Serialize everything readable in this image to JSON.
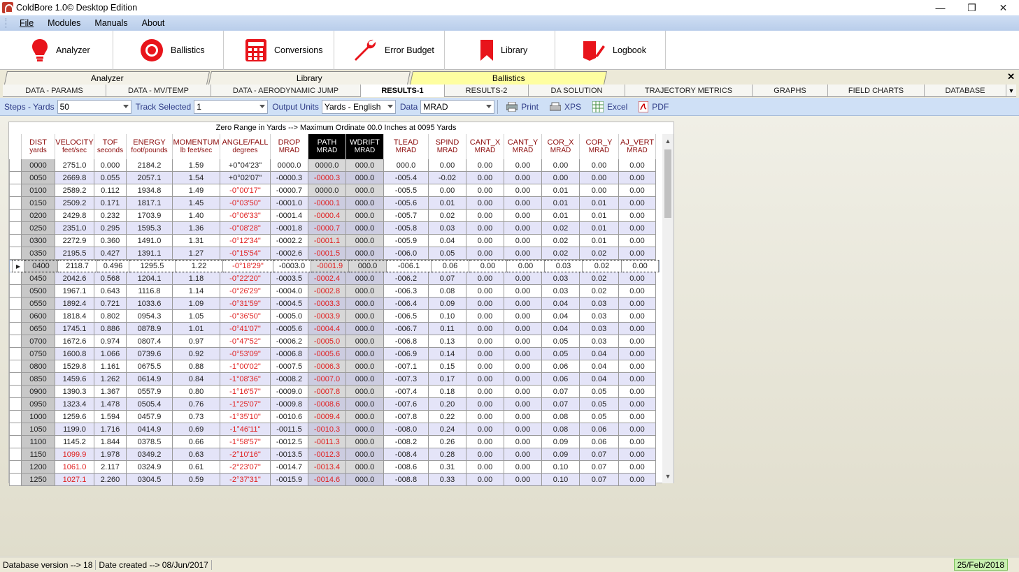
{
  "window": {
    "title": "ColdBore 1.0© Desktop Edition",
    "min": "—",
    "max": "❐",
    "close": "✕"
  },
  "menu": [
    "File",
    "Modules",
    "Manuals",
    "About"
  ],
  "toolbar": [
    {
      "label": "Analyzer",
      "icon": "bulb-icon"
    },
    {
      "label": "Ballistics",
      "icon": "target-icon"
    },
    {
      "label": "Conversions",
      "icon": "calculator-icon"
    },
    {
      "label": "Error Budget",
      "icon": "wrench-icon"
    },
    {
      "label": "Library",
      "icon": "bookmark-icon"
    },
    {
      "label": "Logbook",
      "icon": "book-pen-icon"
    }
  ],
  "sheet_tabs": [
    {
      "label": "Analyzer"
    },
    {
      "label": "Library"
    },
    {
      "label": "Ballistics",
      "active": true
    }
  ],
  "sheet_close": "✕",
  "sub_tabs": [
    "DATA - PARAMS",
    "DATA - MV/TEMP",
    "DATA - AERODYNAMIC JUMP",
    "RESULTS-1",
    "RESULTS-2",
    "DA SOLUTION",
    "TRAJECTORY METRICS",
    "GRAPHS",
    "FIELD CHARTS",
    "DATABASE"
  ],
  "sub_tab_active": "RESULTS-1",
  "controls": {
    "steps_label": "Steps - Yards",
    "steps_value": "50",
    "track_label": "Track Selected",
    "track_value": "1",
    "units_label": "Output Units",
    "units_value": "Yards - English",
    "data_label": "Data",
    "data_value": "MRAD",
    "print": "Print",
    "xps": "XPS",
    "excel": "Excel",
    "pdf": "PDF"
  },
  "zero_banner": "Zero Range in Yards --> Maximum Ordinate 00.0 Inches at 0095 Yards",
  "columns": [
    {
      "t": "DIST",
      "u": "yards"
    },
    {
      "t": "VELOCITY",
      "u": "feet/sec"
    },
    {
      "t": "TOF",
      "u": "seconds"
    },
    {
      "t": "ENERGY",
      "u": "foot/pounds"
    },
    {
      "t": "MOMENTUM",
      "u": "lb feet/sec"
    },
    {
      "t": "ANGLE/FALL",
      "u": "degrees"
    },
    {
      "t": "DROP",
      "u": "MRAD"
    },
    {
      "t": "PATH",
      "u": "MRAD",
      "dark": true
    },
    {
      "t": "WDRIFT",
      "u": "MRAD",
      "dark": true
    },
    {
      "t": "TLEAD",
      "u": "MRAD"
    },
    {
      "t": "SPIND",
      "u": "MRAD"
    },
    {
      "t": "CANT_X",
      "u": "MRAD"
    },
    {
      "t": "CANT_Y",
      "u": "MRAD"
    },
    {
      "t": "COR_X",
      "u": "MRAD"
    },
    {
      "t": "COR_Y",
      "u": "MRAD"
    },
    {
      "t": "AJ_VERT",
      "u": "MRAD"
    }
  ],
  "selected_row": 8,
  "rows": [
    [
      "0000",
      "2751.0",
      "0.000",
      "2184.2",
      "1.59",
      "+0°04'23\"",
      "0000.0",
      "0000.0",
      "000.0",
      "000.0",
      "0.00",
      "0.00",
      "0.00",
      "0.00",
      "0.00",
      "0.00"
    ],
    [
      "0050",
      "2669.8",
      "0.055",
      "2057.1",
      "1.54",
      "+0°02'07\"",
      "-0000.3",
      "-0000.3",
      "000.0",
      "-005.4",
      "-0.02",
      "0.00",
      "0.00",
      "0.00",
      "0.00",
      "0.00"
    ],
    [
      "0100",
      "2589.2",
      "0.112",
      "1934.8",
      "1.49",
      "-0°00'17\"",
      "-0000.7",
      "0000.0",
      "000.0",
      "-005.5",
      "0.00",
      "0.00",
      "0.00",
      "0.01",
      "0.00",
      "0.00"
    ],
    [
      "0150",
      "2509.2",
      "0.171",
      "1817.1",
      "1.45",
      "-0°03'50\"",
      "-0001.0",
      "-0000.1",
      "000.0",
      "-005.6",
      "0.01",
      "0.00",
      "0.00",
      "0.01",
      "0.01",
      "0.00"
    ],
    [
      "0200",
      "2429.8",
      "0.232",
      "1703.9",
      "1.40",
      "-0°06'33\"",
      "-0001.4",
      "-0000.4",
      "000.0",
      "-005.7",
      "0.02",
      "0.00",
      "0.00",
      "0.01",
      "0.01",
      "0.00"
    ],
    [
      "0250",
      "2351.0",
      "0.295",
      "1595.3",
      "1.36",
      "-0°08'28\"",
      "-0001.8",
      "-0000.7",
      "000.0",
      "-005.8",
      "0.03",
      "0.00",
      "0.00",
      "0.02",
      "0.01",
      "0.00"
    ],
    [
      "0300",
      "2272.9",
      "0.360",
      "1491.0",
      "1.31",
      "-0°12'34\"",
      "-0002.2",
      "-0001.1",
      "000.0",
      "-005.9",
      "0.04",
      "0.00",
      "0.00",
      "0.02",
      "0.01",
      "0.00"
    ],
    [
      "0350",
      "2195.5",
      "0.427",
      "1391.1",
      "1.27",
      "-0°15'54\"",
      "-0002.6",
      "-0001.5",
      "000.0",
      "-006.0",
      "0.05",
      "0.00",
      "0.00",
      "0.02",
      "0.02",
      "0.00"
    ],
    [
      "0400",
      "2118.7",
      "0.496",
      "1295.5",
      "1.22",
      "-0°18'29\"",
      "-0003.0",
      "-0001.9",
      "000.0",
      "-006.1",
      "0.06",
      "0.00",
      "0.00",
      "0.03",
      "0.02",
      "0.00"
    ],
    [
      "0450",
      "2042.6",
      "0.568",
      "1204.1",
      "1.18",
      "-0°22'20\"",
      "-0003.5",
      "-0002.4",
      "000.0",
      "-006.2",
      "0.07",
      "0.00",
      "0.00",
      "0.03",
      "0.02",
      "0.00"
    ],
    [
      "0500",
      "1967.1",
      "0.643",
      "1116.8",
      "1.14",
      "-0°26'29\"",
      "-0004.0",
      "-0002.8",
      "000.0",
      "-006.3",
      "0.08",
      "0.00",
      "0.00",
      "0.03",
      "0.02",
      "0.00"
    ],
    [
      "0550",
      "1892.4",
      "0.721",
      "1033.6",
      "1.09",
      "-0°31'59\"",
      "-0004.5",
      "-0003.3",
      "000.0",
      "-006.4",
      "0.09",
      "0.00",
      "0.00",
      "0.04",
      "0.03",
      "0.00"
    ],
    [
      "0600",
      "1818.4",
      "0.802",
      "0954.3",
      "1.05",
      "-0°36'50\"",
      "-0005.0",
      "-0003.9",
      "000.0",
      "-006.5",
      "0.10",
      "0.00",
      "0.00",
      "0.04",
      "0.03",
      "0.00"
    ],
    [
      "0650",
      "1745.1",
      "0.886",
      "0878.9",
      "1.01",
      "-0°41'07\"",
      "-0005.6",
      "-0004.4",
      "000.0",
      "-006.7",
      "0.11",
      "0.00",
      "0.00",
      "0.04",
      "0.03",
      "0.00"
    ],
    [
      "0700",
      "1672.6",
      "0.974",
      "0807.4",
      "0.97",
      "-0°47'52\"",
      "-0006.2",
      "-0005.0",
      "000.0",
      "-006.8",
      "0.13",
      "0.00",
      "0.00",
      "0.05",
      "0.03",
      "0.00"
    ],
    [
      "0750",
      "1600.8",
      "1.066",
      "0739.6",
      "0.92",
      "-0°53'09\"",
      "-0006.8",
      "-0005.6",
      "000.0",
      "-006.9",
      "0.14",
      "0.00",
      "0.00",
      "0.05",
      "0.04",
      "0.00"
    ],
    [
      "0800",
      "1529.8",
      "1.161",
      "0675.5",
      "0.88",
      "-1°00'02\"",
      "-0007.5",
      "-0006.3",
      "000.0",
      "-007.1",
      "0.15",
      "0.00",
      "0.00",
      "0.06",
      "0.04",
      "0.00"
    ],
    [
      "0850",
      "1459.6",
      "1.262",
      "0614.9",
      "0.84",
      "-1°08'36\"",
      "-0008.2",
      "-0007.0",
      "000.0",
      "-007.3",
      "0.17",
      "0.00",
      "0.00",
      "0.06",
      "0.04",
      "0.00"
    ],
    [
      "0900",
      "1390.3",
      "1.367",
      "0557.9",
      "0.80",
      "-1°16'57\"",
      "-0009.0",
      "-0007.8",
      "000.0",
      "-007.4",
      "0.18",
      "0.00",
      "0.00",
      "0.07",
      "0.05",
      "0.00"
    ],
    [
      "0950",
      "1323.4",
      "1.478",
      "0505.4",
      "0.76",
      "-1°25'07\"",
      "-0009.8",
      "-0008.6",
      "000.0",
      "-007.6",
      "0.20",
      "0.00",
      "0.00",
      "0.07",
      "0.05",
      "0.00"
    ],
    [
      "1000",
      "1259.6",
      "1.594",
      "0457.9",
      "0.73",
      "-1°35'10\"",
      "-0010.6",
      "-0009.4",
      "000.0",
      "-007.8",
      "0.22",
      "0.00",
      "0.00",
      "0.08",
      "0.05",
      "0.00"
    ],
    [
      "1050",
      "1199.0",
      "1.716",
      "0414.9",
      "0.69",
      "-1°46'11\"",
      "-0011.5",
      "-0010.3",
      "000.0",
      "-008.0",
      "0.24",
      "0.00",
      "0.00",
      "0.08",
      "0.06",
      "0.00"
    ],
    [
      "1100",
      "1145.2",
      "1.844",
      "0378.5",
      "0.66",
      "-1°58'57\"",
      "-0012.5",
      "-0011.3",
      "000.0",
      "-008.2",
      "0.26",
      "0.00",
      "0.00",
      "0.09",
      "0.06",
      "0.00"
    ],
    [
      "1150",
      "1099.9",
      "1.978",
      "0349.2",
      "0.63",
      "-2°10'16\"",
      "-0013.5",
      "-0012.3",
      "000.0",
      "-008.4",
      "0.28",
      "0.00",
      "0.00",
      "0.09",
      "0.07",
      "0.00"
    ],
    [
      "1200",
      "1061.0",
      "2.117",
      "0324.9",
      "0.61",
      "-2°23'07\"",
      "-0014.7",
      "-0013.4",
      "000.0",
      "-008.6",
      "0.31",
      "0.00",
      "0.00",
      "0.10",
      "0.07",
      "0.00"
    ],
    [
      "1250",
      "1027.1",
      "2.260",
      "0304.5",
      "0.59",
      "-2°37'31\"",
      "-0015.9",
      "-0014.6",
      "000.0",
      "-008.8",
      "0.33",
      "0.00",
      "0.00",
      "0.10",
      "0.07",
      "0.00"
    ]
  ],
  "status": {
    "db_version": "Database version --> 18",
    "date_created": "Date created --> 08/Jun/2017",
    "today": "25/Feb/2018"
  },
  "colors": {
    "header_text": "#8b0a0a",
    "negative": "#e02020",
    "active_sheet_tab": "#fefea0",
    "ctrl_bar": "#cfe0f6"
  }
}
